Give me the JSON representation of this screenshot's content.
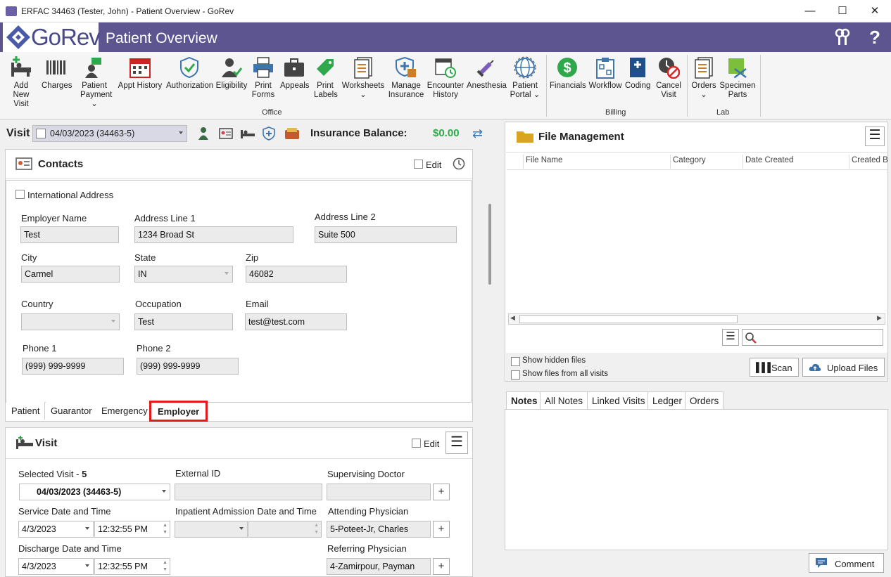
{
  "window": {
    "title": "ERFAC 34463 (Tester, John) - Patient Overview - GoRev",
    "minimize": "—",
    "maximize": "☐",
    "close": "✕"
  },
  "header": {
    "logo_text": "GoRev",
    "page_title": "Patient Overview"
  },
  "ribbon": {
    "office": [
      {
        "line1": "Add New",
        "line2": "Visit",
        "icon": "add-visit-icon"
      },
      {
        "line1": "Charges",
        "line2": "",
        "icon": "barcode-icon"
      },
      {
        "line1": "Patient",
        "line2": "Payment ⌄",
        "icon": "payment-icon"
      },
      {
        "line1": "Appt History",
        "line2": "",
        "icon": "calendar-icon"
      },
      {
        "line1": "Authorization",
        "line2": "",
        "icon": "shield-check-icon"
      },
      {
        "line1": "Eligibility",
        "line2": "",
        "icon": "user-check-icon"
      },
      {
        "line1": "Print",
        "line2": "Forms",
        "icon": "printer-icon"
      },
      {
        "line1": "Appeals",
        "line2": "",
        "icon": "briefcase-icon"
      },
      {
        "line1": "Print",
        "line2": "Labels",
        "icon": "tag-icon"
      },
      {
        "line1": "Worksheets",
        "line2": "⌄",
        "icon": "worksheet-icon"
      },
      {
        "line1": "Manage",
        "line2": "Insurance",
        "icon": "insurance-icon"
      },
      {
        "line1": "Encounter",
        "line2": "History",
        "icon": "encounter-icon"
      },
      {
        "line1": "Anesthesia",
        "line2": "",
        "icon": "syringe-icon"
      },
      {
        "line1": "Patient",
        "line2": "Portal ⌄",
        "icon": "globe-icon"
      }
    ],
    "billing": [
      {
        "line1": "Financials",
        "line2": "",
        "icon": "dollar-icon"
      },
      {
        "line1": "Workflow",
        "line2": "",
        "icon": "workflow-icon"
      },
      {
        "line1": "Coding",
        "line2": "",
        "icon": "book-icon"
      },
      {
        "line1": "Cancel",
        "line2": "Visit",
        "icon": "cancel-clock-icon"
      }
    ],
    "lab": [
      {
        "line1": "Orders",
        "line2": "⌄",
        "icon": "orders-icon"
      },
      {
        "line1": "Specimen",
        "line2": "Parts",
        "icon": "specimen-icon"
      }
    ],
    "group_office": "Office",
    "group_billing": "Billing",
    "group_lab": "Lab"
  },
  "visitbar": {
    "label": "Visit",
    "selected": "04/03/2023 (34463-5)",
    "insurance_label": "Insurance Balance:",
    "insurance_value": "$0.00",
    "accent": "#2ea84a"
  },
  "contacts": {
    "title": "Contacts",
    "edit_label": "Edit",
    "international": "International Address",
    "employer_name_label": "Employer Name",
    "employer_name": "Test",
    "address1_label": "Address Line 1",
    "address1": "1234 Broad St",
    "address2_label": "Address Line 2",
    "address2": "Suite 500",
    "city_label": "City",
    "city": "Carmel",
    "state_label": "State",
    "state": "IN",
    "zip_label": "Zip",
    "zip": "46082",
    "country_label": "Country",
    "country": "",
    "occupation_label": "Occupation",
    "occupation": "Test",
    "email_label": "Email",
    "email": "test@test.com",
    "phone1_label": "Phone 1",
    "phone1": "(999) 999-9999",
    "phone2_label": "Phone 2",
    "phone2": "(999) 999-9999",
    "tabs": [
      "Patient",
      "Guarantor",
      "Emergency",
      "Employer"
    ],
    "active_tab": "Employer"
  },
  "visit": {
    "title": "Visit",
    "edit_label": "Edit",
    "selected_visit_label": "Selected Visit -",
    "selected_visit_num": "5",
    "selected_visit": "04/03/2023 (34463-5)",
    "external_id_label": "External ID",
    "external_id": "",
    "supervising_label": "Supervising Doctor",
    "supervising": "",
    "service_label": "Service Date and Time",
    "service_date": "4/3/2023",
    "service_time": "12:32:55 PM",
    "inpatient_label": "Inpatient Admission Date and Time",
    "attending_label": "Attending Physician",
    "attending": "5-Poteet-Jr, Charles",
    "discharge_label": "Discharge Date and Time",
    "discharge_date": "4/3/2023",
    "discharge_time": "12:32:55 PM",
    "referring_label": "Referring Physician",
    "referring": "4-Zamirpour, Payman"
  },
  "files": {
    "title": "File Management",
    "columns": [
      "File Name",
      "Category",
      "Date Created",
      "Created B"
    ],
    "show_hidden": "Show hidden files",
    "show_all": "Show files from all visits",
    "scan": "Scan",
    "upload": "Upload Files",
    "search_placeholder": ""
  },
  "notes": {
    "tabs": [
      "Notes",
      "All Notes",
      "Linked Visits",
      "Ledger",
      "Orders"
    ],
    "active_tab": "Notes",
    "comment": "Comment"
  }
}
